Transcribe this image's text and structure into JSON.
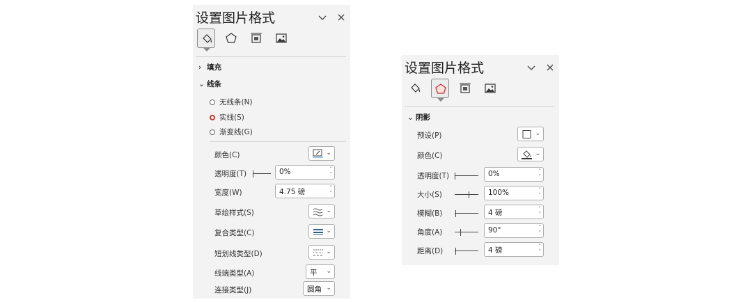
{
  "panel_left": {
    "title": "设置图片格式",
    "fill_section": "填充",
    "line_section": "线条",
    "radios": [
      {
        "label": "无线条(N)",
        "checked": false
      },
      {
        "label": "实线(S)",
        "checked": true
      },
      {
        "label": "渐变线(G)",
        "checked": false
      }
    ],
    "props": {
      "color_label": "颜色(C)",
      "transparency_label": "透明度(T)",
      "transparency_value": "0%",
      "width_label": "宽度(W)",
      "width_value": "4.75 磅",
      "sketch_label": "草绘样式(S)",
      "compound_label": "复合类型(C)",
      "dash_label": "短划线类型(D)",
      "cap_label": "线端类型(A)",
      "cap_value": "平",
      "join_label": "连接类型(J)",
      "join_value": "圆角"
    }
  },
  "panel_right": {
    "title": "设置图片格式",
    "shadow_section": "阴影",
    "props": {
      "preset_label": "预设(P)",
      "color_label": "颜色(C)",
      "transparency_label": "透明度(T)",
      "transparency_value": "0%",
      "size_label": "大小(S)",
      "size_value": "100%",
      "blur_label": "模糊(B)",
      "blur_value": "4 磅",
      "angle_label": "角度(A)",
      "angle_value": "90°",
      "distance_label": "距离(D)",
      "distance_value": "4 磅"
    }
  },
  "colors": {
    "accent_radio": "#c0392b",
    "panel_bg": "#f3f3f3"
  }
}
